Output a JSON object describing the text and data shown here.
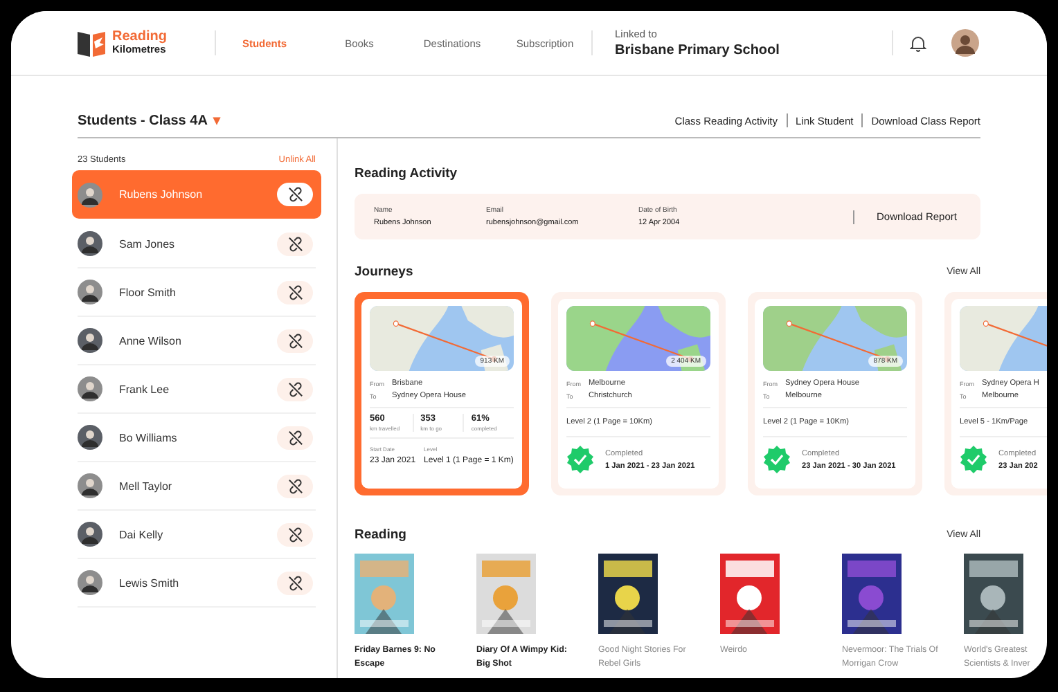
{
  "header": {
    "logo_line1": "Reading",
    "logo_line2": "Kilometres",
    "nav": [
      {
        "label": "Students",
        "selected": true
      },
      {
        "label": "Books",
        "selected": false
      },
      {
        "label": "Destinations",
        "selected": false
      },
      {
        "label": "Subscription",
        "selected": false
      }
    ],
    "linked_label": "Linked to",
    "school": "Brisbane Primary School"
  },
  "class_title": "Students - Class 4A",
  "class_caret": "▾",
  "actions": [
    "Class Reading Activity",
    "Link Student",
    "Download Class Report"
  ],
  "sidebar": {
    "count": "23 Students",
    "unlink_all": "Unlink All",
    "students": [
      {
        "name": "Rubens Johnson",
        "selected": true
      },
      {
        "name": "Sam Jones",
        "selected": false
      },
      {
        "name": "Floor Smith",
        "selected": false
      },
      {
        "name": "Anne Wilson",
        "selected": false
      },
      {
        "name": "Frank Lee",
        "selected": false
      },
      {
        "name": "Bo Williams",
        "selected": false
      },
      {
        "name": "Mell Taylor",
        "selected": false
      },
      {
        "name": "Dai Kelly",
        "selected": false
      },
      {
        "name": "Lewis Smith",
        "selected": false
      }
    ]
  },
  "activity": {
    "title": "Reading Activity",
    "fields": [
      {
        "label": "Name",
        "value": "Rubens Johnson"
      },
      {
        "label": "Email",
        "value": "rubensjohnson@gmail.com"
      },
      {
        "label": "Date of Birth",
        "value": "12 Apr 2004"
      }
    ],
    "download": "Download Report"
  },
  "journeys": {
    "title": "Journeys",
    "view_all": "View All",
    "items": [
      {
        "kind": "active",
        "selected": true,
        "distance": "913 KM",
        "from_label": "From",
        "from": "Brisbane",
        "to_label": "To",
        "to": "Sydney Opera House",
        "stats": [
          {
            "value": "560",
            "label": "km travelled"
          },
          {
            "value": "353",
            "label": "km to go"
          },
          {
            "value": "61%",
            "label": "completed"
          }
        ],
        "start_label": "Start Date",
        "start": "23 Jan 2021",
        "level_label": "Level",
        "level_text": "Level 1 (1 Page = 1 Km)"
      },
      {
        "kind": "completed",
        "selected": false,
        "distance": "2 404 KM",
        "from_label": "From",
        "from": "Melbourne",
        "to_label": "To",
        "to": "Christchurch",
        "level_text": "Level 2 (1 Page = 10Km)",
        "status": "Completed",
        "dates": "1 Jan 2021 - 23 Jan 2021"
      },
      {
        "kind": "completed",
        "selected": false,
        "distance": "878 KM",
        "from_label": "From",
        "from": "Sydney Opera House",
        "to_label": "To",
        "to": "Melbourne",
        "level_text": "Level 2 (1 Page = 10Km)",
        "status": "Completed",
        "dates": "23 Jan 2021 - 30 Jan 2021"
      },
      {
        "kind": "completed",
        "selected": false,
        "from_label": "From",
        "from": "Sydney Opera H",
        "to_label": "To",
        "to": "Melbourne",
        "level_text": "Level 5 - 1Km/Page",
        "status": "Completed",
        "dates": "23 Jan 202"
      }
    ]
  },
  "reading": {
    "title": "Reading",
    "view_all": "View All",
    "books": [
      {
        "title": "Friday Barnes 9: No Escape",
        "completed": false
      },
      {
        "title": "Diary Of A Wimpy Kid: Big Shot",
        "completed": false
      },
      {
        "title": "Good Night Stories For Rebel Girls",
        "completed": true
      },
      {
        "title": "Weirdo",
        "completed": true
      },
      {
        "title": "Nevermoor: The Trials Of Morrigan Crow",
        "completed": true
      },
      {
        "title": "World's Greatest Scientists & Inver",
        "completed": true
      }
    ]
  }
}
